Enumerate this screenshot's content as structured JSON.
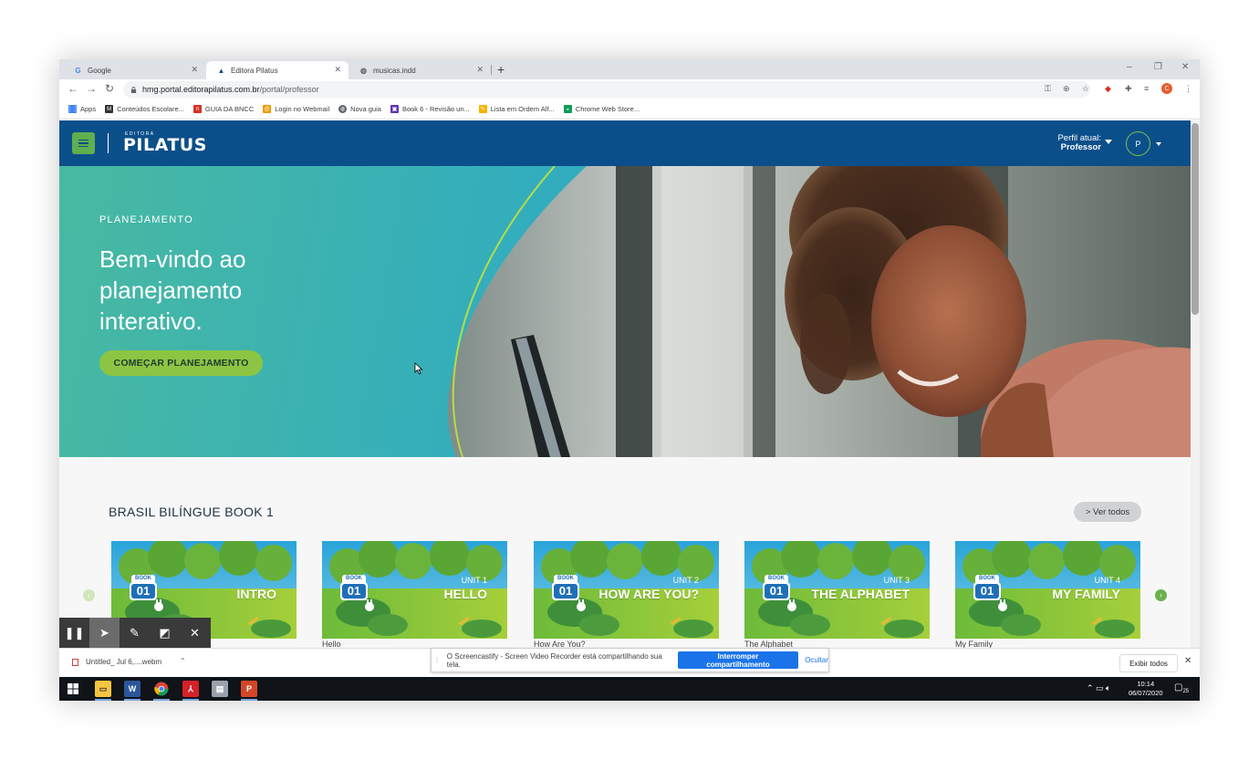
{
  "browser": {
    "tabs": [
      {
        "title": "Google",
        "favicon": "google-icon"
      },
      {
        "title": "Editora Pilatus",
        "favicon": "pilatus-icon"
      },
      {
        "title": "musicas.indd",
        "favicon": "globe-icon"
      }
    ],
    "active_tab": 1,
    "url_host": "hmg.portal.editorapilatus.com.br",
    "url_path": "/portal/professor",
    "bookmarks": [
      {
        "label": "Apps",
        "icon": "apps-grid-icon",
        "color": "#4285f4"
      },
      {
        "label": "Conteúdos Escolare...",
        "icon": "site-icon",
        "color": "#333333"
      },
      {
        "label": "GUIA DA BNCC",
        "icon": "n-icon",
        "color": "#d93025"
      },
      {
        "label": "Login no Webmail",
        "icon": "webmail-icon",
        "color": "#f29900"
      },
      {
        "label": "Nova guia",
        "icon": "globe-icon",
        "color": "#5f6368"
      },
      {
        "label": "Book 6 - Revisão un...",
        "icon": "book-icon",
        "color": "#5e35b1"
      },
      {
        "label": "Lista em Ordem Alf...",
        "icon": "doc-icon",
        "color": "#f4b400"
      },
      {
        "label": "Chrome Web Store...",
        "icon": "webstore-icon",
        "color": "#0f9d58"
      }
    ]
  },
  "header": {
    "logo_small": "EDITORA",
    "logo": "PILATUS",
    "profile_label": "Perfil atual:",
    "profile_value": "Professor",
    "avatar_initial": "P"
  },
  "hero": {
    "kicker": "PLANEJAMENTO",
    "title": "Bem-vindo ao planejamento interativo.",
    "cta": "COMEÇAR PLANEJAMENTO"
  },
  "section": {
    "title": "BRASIL BILÍNGUE BOOK 1",
    "see_all": "> Ver todos",
    "cards": [
      {
        "badge_top": "BOOK",
        "badge_num": "01",
        "unit": "",
        "banner": "INTRO",
        "label": ""
      },
      {
        "badge_top": "BOOK",
        "badge_num": "01",
        "unit": "UNIT 1",
        "banner": "HELLO",
        "label": "Hello"
      },
      {
        "badge_top": "BOOK",
        "badge_num": "01",
        "unit": "UNIT 2",
        "banner": "HOW ARE YOU?",
        "label": "How Are You?"
      },
      {
        "badge_top": "BOOK",
        "badge_num": "01",
        "unit": "UNIT 3",
        "banner": "THE ALPHABET",
        "label": "The Alphabet"
      },
      {
        "badge_top": "BOOK",
        "badge_num": "01",
        "unit": "UNIT 4",
        "banner": "MY FAMILY",
        "label": "My Family"
      }
    ]
  },
  "shelf": {
    "download_name": "Untitled_ Jul 6,....webm",
    "share_message": "O Screencastify - Screen Video Recorder está compartilhando sua tela.",
    "stop_sharing": "Interromper compartilhamento",
    "hide": "Ocultar",
    "show_all": "Exibir todos"
  },
  "taskbar": {
    "time": "10:14",
    "date": "06/07/2020",
    "notifications": "25"
  },
  "colors": {
    "header_blue": "#0b4f8a",
    "accent_green": "#8cc543",
    "chrome_blue": "#1a73e8"
  }
}
